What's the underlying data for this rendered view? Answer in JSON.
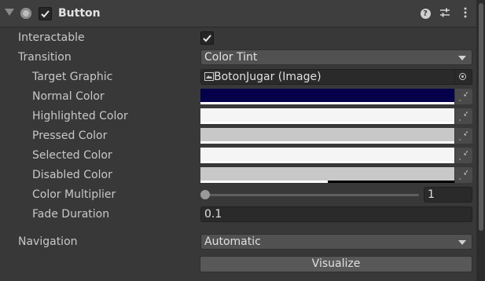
{
  "component": {
    "title": "Button",
    "enabled": true,
    "icons": {
      "foldout": "foldout-arrow-icon",
      "component": "component-icon",
      "help": "help-icon",
      "preset": "preset-icon",
      "menu": "kebab-menu-icon"
    }
  },
  "fields": {
    "interactable": {
      "label": "Interactable",
      "checked": true
    },
    "transition": {
      "label": "Transition",
      "value": "Color Tint"
    },
    "target_graphic": {
      "label": "Target Graphic",
      "value": "BotonJugar (Image)"
    },
    "normal_color": {
      "label": "Normal Color",
      "color": "#04004a",
      "alpha": 1.0
    },
    "highlighted_color": {
      "label": "Highlighted Color",
      "color": "#f5f5f5",
      "alpha": 1.0
    },
    "pressed_color": {
      "label": "Pressed Color",
      "color": "#c8c8c8",
      "alpha": 1.0
    },
    "selected_color": {
      "label": "Selected Color",
      "color": "#f5f5f5",
      "alpha": 1.0
    },
    "disabled_color": {
      "label": "Disabled Color",
      "color": "#c8c8c8",
      "alpha": 0.5
    },
    "color_multiplier": {
      "label": "Color Multiplier",
      "value": "1",
      "slider_fraction": 0.0
    },
    "fade_duration": {
      "label": "Fade Duration",
      "value": "0.1"
    },
    "navigation": {
      "label": "Navigation",
      "value": "Automatic"
    }
  },
  "visualize_button": {
    "label": "Visualize"
  }
}
